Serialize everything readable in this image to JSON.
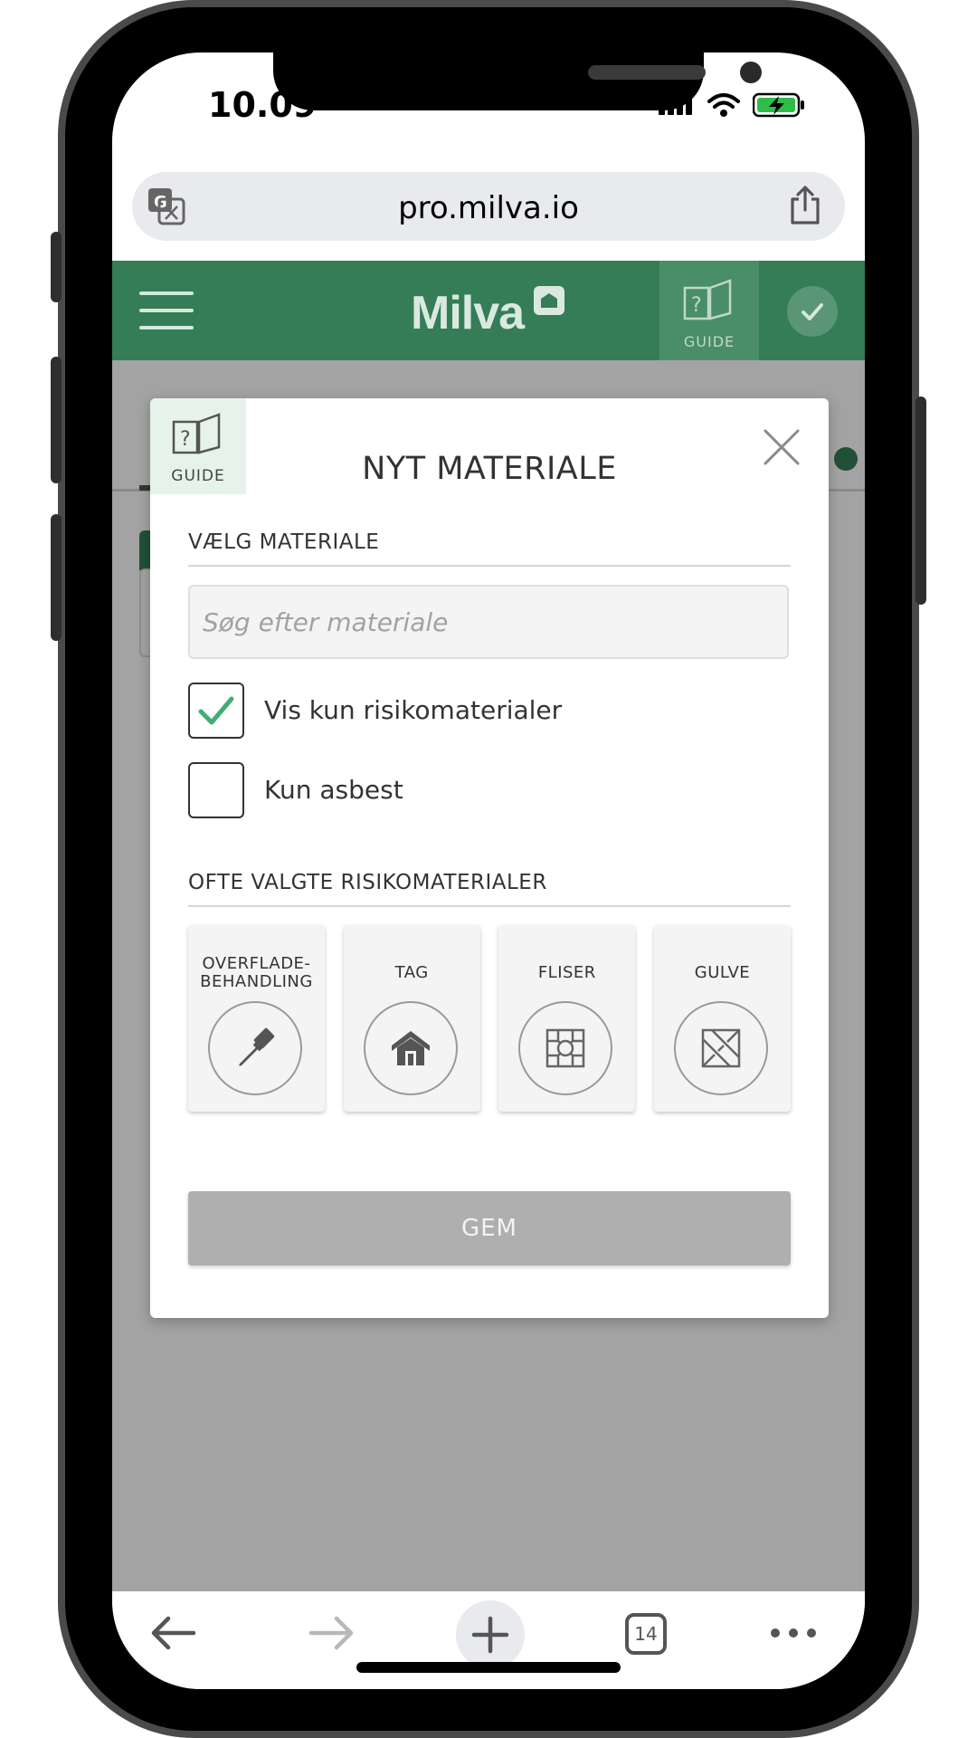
{
  "status_bar": {
    "time": "10.09"
  },
  "browser": {
    "url": "pro.milva.io",
    "tab_count": "14"
  },
  "app_header": {
    "logo": "Milva",
    "guide_label": "GUIDE"
  },
  "modal": {
    "guide_label": "GUIDE",
    "title": "NYT MATERIALE",
    "choose_section_label": "VÆLG MATERIALE",
    "search_placeholder": "Søg efter materiale",
    "checkboxes": [
      {
        "label": "Vis kun risikomaterialer",
        "checked": true
      },
      {
        "label": "Kun asbest",
        "checked": false
      }
    ],
    "frequent_section_label": "OFTE VALGTE RISIKOMATERIALER",
    "tiles": [
      {
        "label": "OVERFLADE-\nBEHANDLING",
        "icon": "paint-brush-icon"
      },
      {
        "label": "TAG",
        "icon": "house-icon"
      },
      {
        "label": "FLISER",
        "icon": "tiles-icon"
      },
      {
        "label": "GULVE",
        "icon": "floor-icon"
      }
    ],
    "save_label": "GEM"
  },
  "colors": {
    "brand_green": "#347d57",
    "check_green": "#3fae74",
    "disabled_button": "#afafaf"
  }
}
